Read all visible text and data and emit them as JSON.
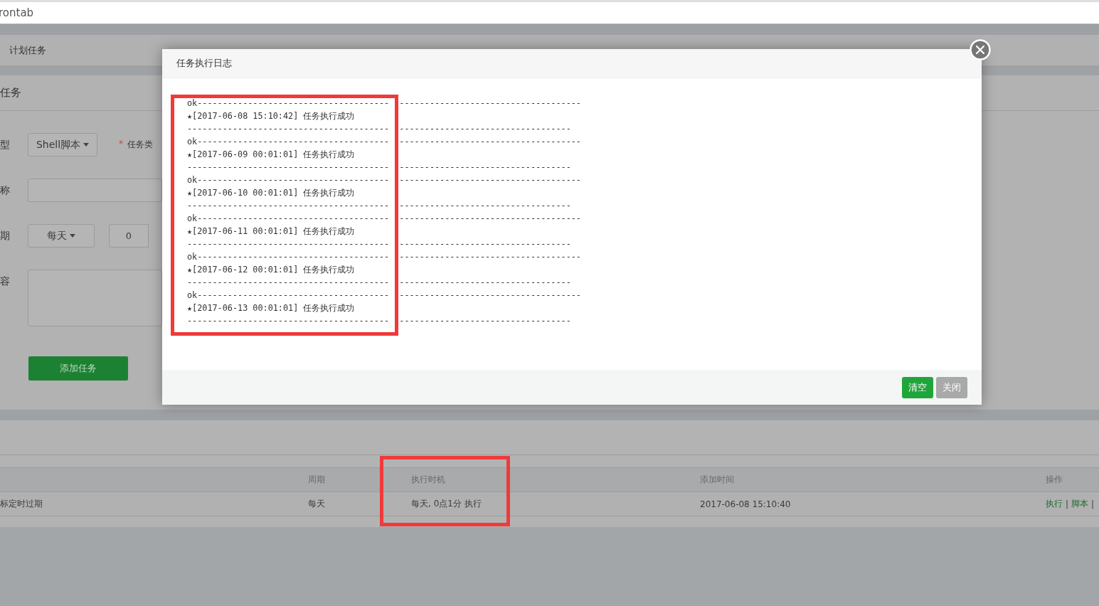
{
  "address_bar": {
    "text": "rontab"
  },
  "breadcrumb": {
    "current": "计划任务"
  },
  "form": {
    "title": "任务",
    "rows": [
      {
        "kind": "select-pair",
        "label": "型",
        "select": "Shell脚本",
        "required_mark": "*",
        "extra_label": "任务类"
      },
      {
        "kind": "input",
        "label": "称"
      },
      {
        "kind": "period",
        "label": "期",
        "select": "每天",
        "number": "0"
      },
      {
        "kind": "textarea",
        "label": "容"
      }
    ],
    "submit": "添加任务"
  },
  "table": {
    "columns": [
      "",
      "周期",
      "执行时机",
      "添加时间",
      "操作"
    ],
    "rows": [
      {
        "cells": [
          "标定时过期",
          "每天",
          "每天, 0点1分 执行",
          "2017-06-08 15:10:40"
        ],
        "actions": [
          "执行",
          "脚本"
        ],
        "separator": "|"
      }
    ]
  },
  "modal": {
    "title": "任务执行日志",
    "log": [
      {
        "head": [
          "ok--------------------------------------",
          "------------------------------------"
        ],
        "line": "★[2017-06-08 15:10:42] 任务执行成功",
        "rule": [
          "----------------------------------------",
          "----------------------------------"
        ]
      },
      {
        "head": [
          "ok--------------------------------------",
          "------------------------------------"
        ],
        "line": "★[2017-06-09 00:01:01] 任务执行成功",
        "rule": [
          "----------------------------------------",
          "----------------------------------"
        ]
      },
      {
        "head": [
          "ok--------------------------------------",
          "------------------------------------"
        ],
        "line": "★[2017-06-10 00:01:01] 任务执行成功",
        "rule": [
          "----------------------------------------",
          "----------------------------------"
        ]
      },
      {
        "head": [
          "ok--------------------------------------",
          "------------------------------------"
        ],
        "line": "★[2017-06-11 00:01:01] 任务执行成功",
        "rule": [
          "----------------------------------------",
          "----------------------------------"
        ]
      },
      {
        "head": [
          "ok--------------------------------------",
          "------------------------------------"
        ],
        "line": "★[2017-06-12 00:01:01] 任务执行成功",
        "rule": [
          "----------------------------------------",
          "----------------------------------"
        ]
      },
      {
        "head": [
          "ok--------------------------------------",
          "------------------------------------"
        ],
        "line": "★[2017-06-13 00:01:01] 任务执行成功",
        "rule": [
          "----------------------------------------",
          "----------------------------------"
        ]
      }
    ],
    "buttons": [
      {
        "label": "清空",
        "disabled": false
      },
      {
        "label": "关闭",
        "disabled": true
      }
    ]
  }
}
